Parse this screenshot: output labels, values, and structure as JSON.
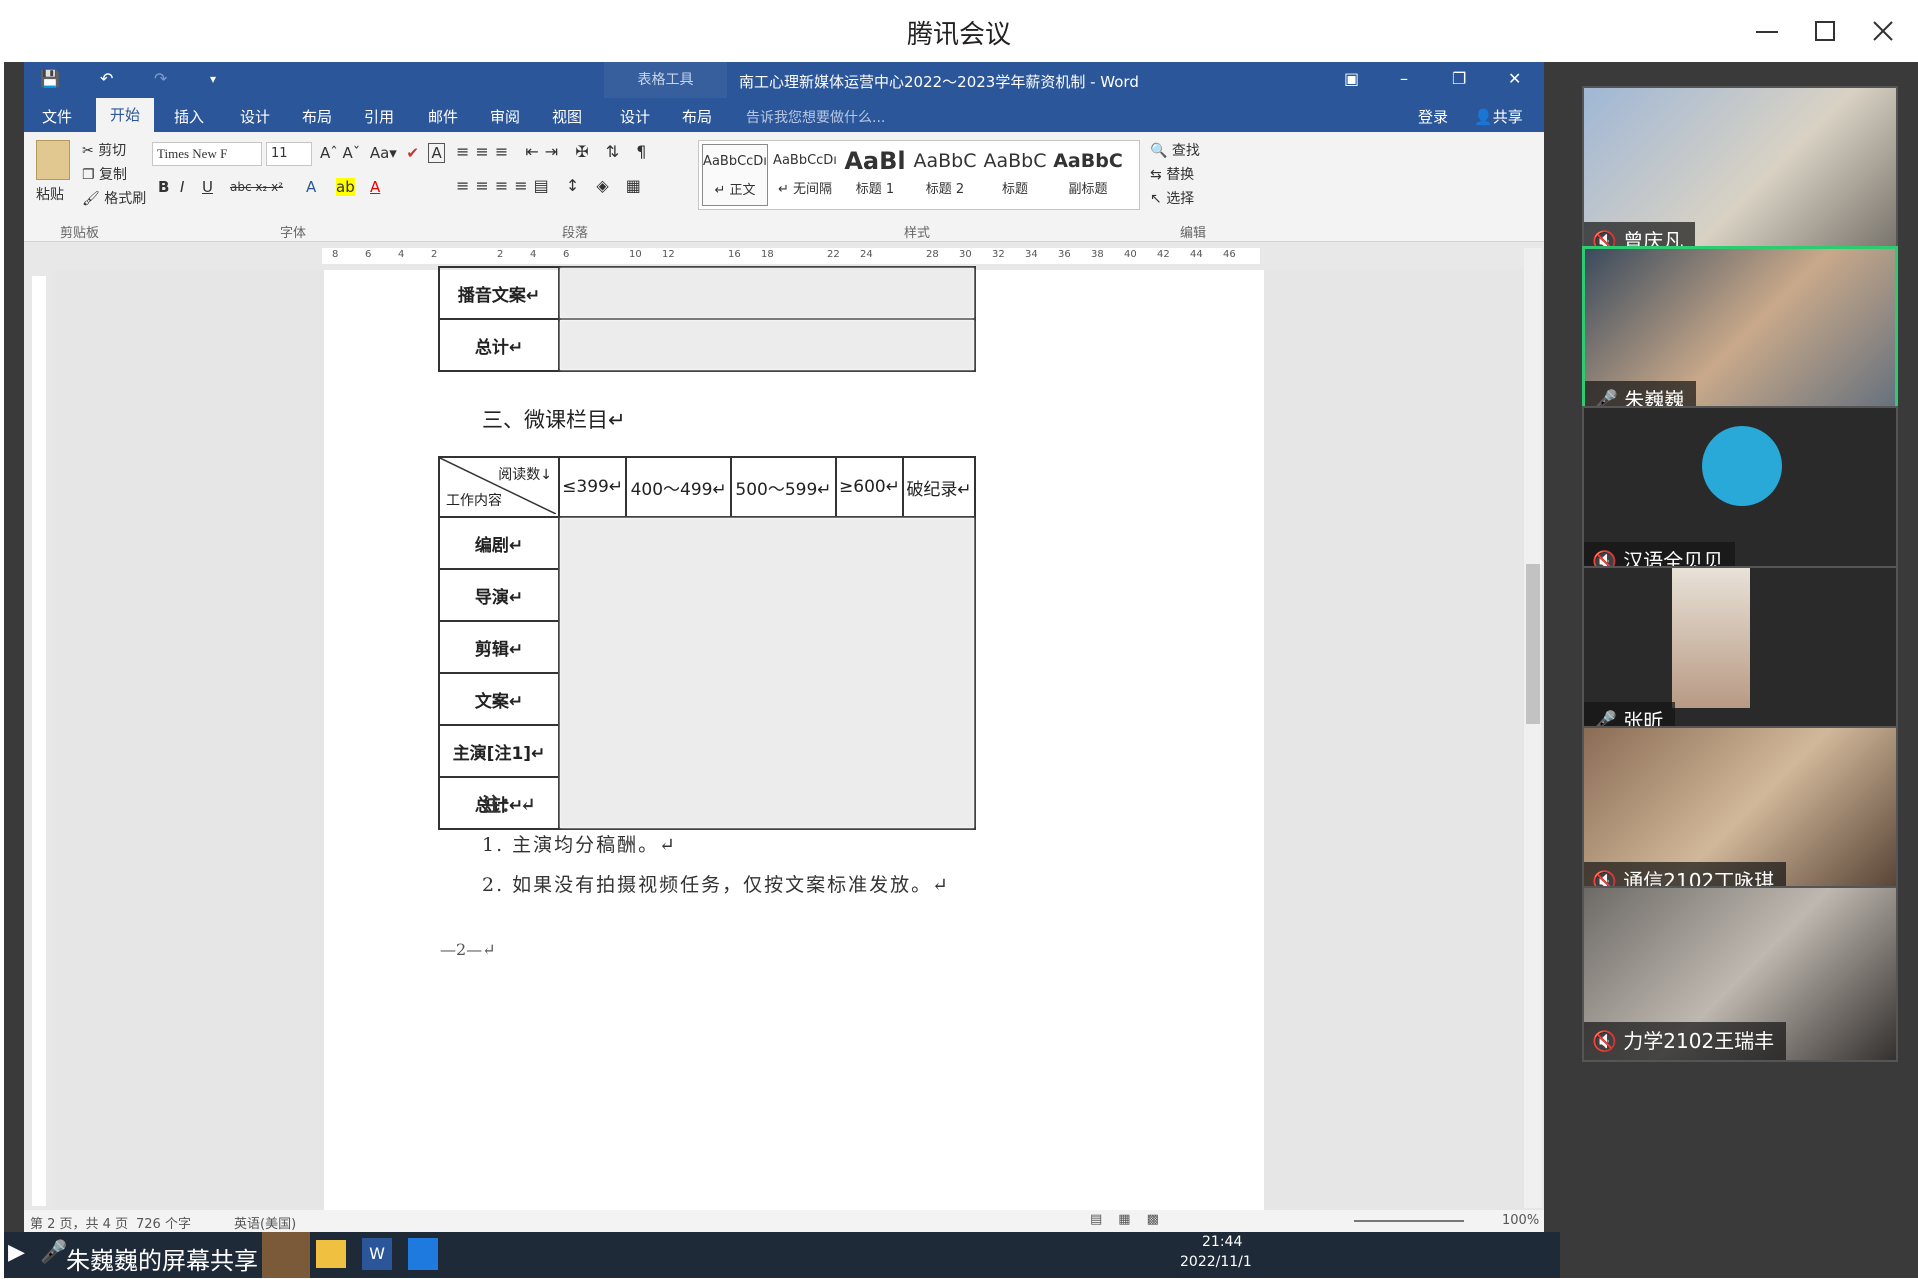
{
  "app": {
    "title": "腾讯会议"
  },
  "word": {
    "doc_title": "南工心理新媒体运营中心2022～2023学年薪资机制 - Word",
    "table_tools": "表格工具",
    "login": "登录",
    "share": "共享",
    "menu": [
      "文件",
      "开始",
      "插入",
      "设计",
      "布局",
      "引用",
      "邮件",
      "审阅",
      "视图",
      "设计",
      "布局"
    ],
    "tell_me": "告诉我您想要做什么...",
    "clipboard": {
      "paste": "粘贴",
      "cut": "剪切",
      "copy": "复制",
      "format_painter": "格式刷",
      "group": "剪贴板"
    },
    "font": {
      "name": "Times New F",
      "size": "11",
      "group": "字体"
    },
    "paragraph_group": "段落",
    "styles": {
      "group": "样式",
      "items": [
        {
          "sample": "AaBbCcDı",
          "name": "↵ 正文"
        },
        {
          "sample": "AaBbCcDı",
          "name": "↵ 无间隔"
        },
        {
          "sample": "AaBl",
          "name": "标题 1"
        },
        {
          "sample": "AaBbC",
          "name": "标题 2"
        },
        {
          "sample": "AaBbC",
          "name": "标题"
        },
        {
          "sample": "AaBbC",
          "name": "副标题"
        }
      ]
    },
    "editing": {
      "find": "查找",
      "replace": "替换",
      "select": "选择",
      "group": "编辑"
    },
    "ruler_ticks": [
      "8",
      "6",
      "4",
      "2",
      "",
      "2",
      "4",
      "6",
      "",
      "10",
      "12",
      "",
      "16",
      "18",
      "",
      "22",
      "24",
      "",
      "28",
      "30",
      "32",
      "34",
      "36",
      "38",
      "40",
      "42",
      "44",
      "46"
    ],
    "status": {
      "page": "第 2 页，共 4 页",
      "words": "726 个字",
      "lang": "英语(美国)",
      "zoom": "100%"
    }
  },
  "document": {
    "table1": {
      "rows": [
        "播音文案↵",
        "总计↵"
      ]
    },
    "section_heading": "三、微课栏目↵",
    "table2": {
      "corner_top": "阅读数↓",
      "corner_bottom": "工作内容",
      "headers": [
        "≤399↵",
        "400～499↵",
        "500～599↵",
        "≥600↵",
        "破纪录↵"
      ],
      "rows": [
        "编剧↵",
        "导演↵",
        "剪辑↵",
        "文案↵",
        "主演[注1]↵",
        "总计↵"
      ]
    },
    "note_title": "注：↵",
    "notes": [
      "1. 主演均分稿酬。↵",
      "2. 如果没有拍摄视频任务，仅按文案标准发放。↵"
    ],
    "page_number": "—2—↵"
  },
  "taskbar": {
    "share_label": "朱巍巍的屏幕共享",
    "time": "21:44",
    "date": "2022/11/1"
  },
  "participants": [
    {
      "name": "曾庆凡",
      "mic": "muted"
    },
    {
      "name": "朱巍巍",
      "mic": "on"
    },
    {
      "name": "汉语全贝贝",
      "mic": "muted"
    },
    {
      "name": "张昕",
      "mic": "on"
    },
    {
      "name": "通信2102丁咏琪",
      "mic": "muted"
    },
    {
      "name": "力学2102王瑞丰",
      "mic": "muted"
    }
  ]
}
